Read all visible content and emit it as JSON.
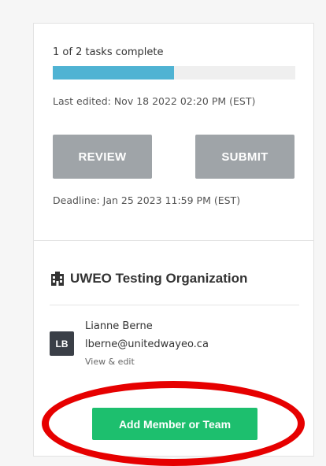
{
  "progress": {
    "label": "1 of 2 tasks complete",
    "completed": 1,
    "total": 2,
    "fraction": 0.5
  },
  "last_edited": "Last edited: Nov 18 2022 02:20 PM (EST)",
  "actions": {
    "review_label": "REVIEW",
    "submit_label": "SUBMIT"
  },
  "deadline": "Deadline: Jan 25 2023 11:59 PM (EST)",
  "organization": {
    "name": "UWEO Testing Organization",
    "icon": "building-icon"
  },
  "member": {
    "initials": "LB",
    "name": "Lianne Berne",
    "email": "lberne@unitedwayeo.ca",
    "link_label": "View & edit"
  },
  "add_button_label": "Add Member or Team",
  "colors": {
    "progress_fill": "#4fb3d3",
    "progress_track": "#efefef",
    "disabled_button": "#9fa4a8",
    "primary_button": "#1dbf6e",
    "avatar_bg": "#3a3f47",
    "highlight": "#e60000"
  }
}
